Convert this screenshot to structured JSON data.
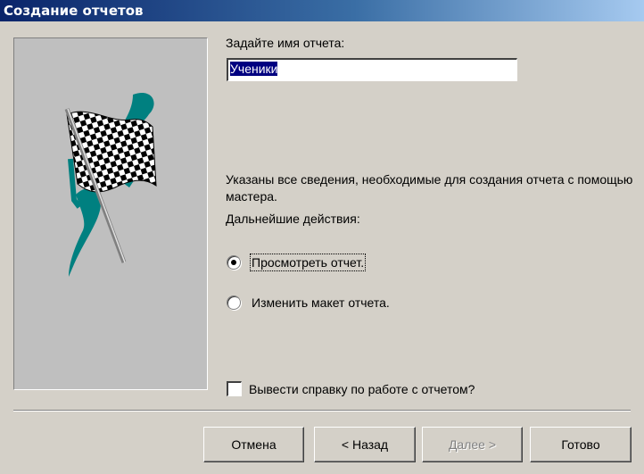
{
  "window": {
    "title": "Создание отчетов"
  },
  "form": {
    "name_label": "Задайте имя отчета:",
    "name_value": "Ученики",
    "info_text": "Указаны все сведения, необходимые для создания отчета с помощью мастера.",
    "next_label": "Дальнейшие действия:",
    "options": [
      {
        "label": "Просмотреть отчет.",
        "selected": true
      },
      {
        "label": "Изменить макет отчета.",
        "selected": false
      }
    ],
    "help_checkbox": {
      "label": "Вывести справку по работе с отчетом?",
      "checked": false
    }
  },
  "buttons": {
    "cancel": "Отмена",
    "back": "< Назад",
    "next": "Далее >",
    "next_enabled": false,
    "finish": "Готово"
  },
  "icons": {
    "wizard_image": "checkered-flag-icon"
  },
  "colors": {
    "window_bg": "#d4d0c8",
    "title_start": "#0a246a",
    "title_end": "#a6caf0",
    "flag_teal": "#008080",
    "selection": "#000080"
  }
}
